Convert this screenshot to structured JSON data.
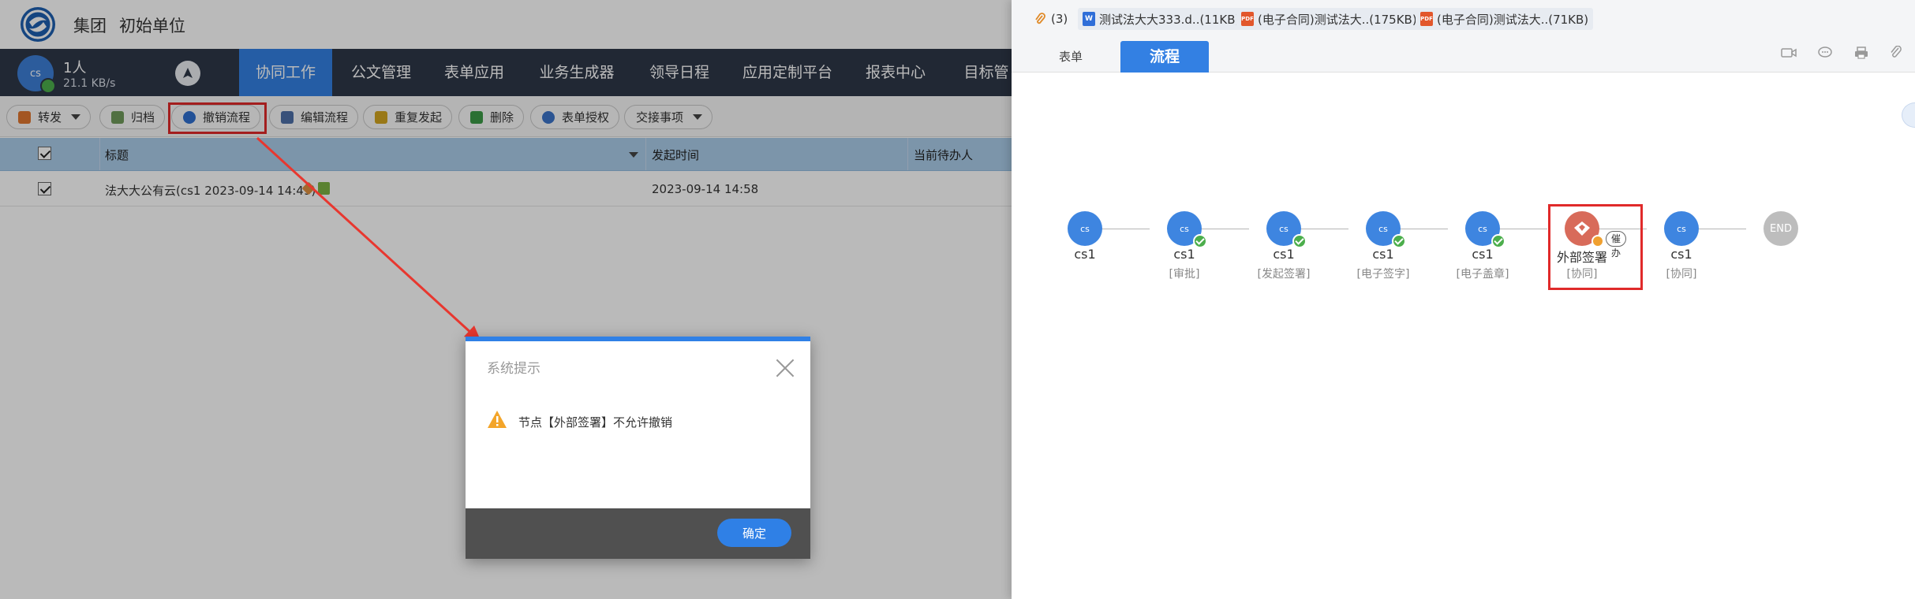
{
  "header": {
    "group": "集团",
    "unit": "初始单位"
  },
  "nav": {
    "avatar": "cs",
    "user": "1人",
    "speed": "21.1 KB/s",
    "tabs": [
      "协同工作",
      "公文管理",
      "表单应用",
      "业务生成器",
      "领导日程",
      "应用定制平台",
      "报表中心",
      "目标管"
    ]
  },
  "toolbar": {
    "forward": "转发",
    "archive": "归档",
    "revoke": "撤销流程",
    "edit": "编辑流程",
    "resend": "重复发起",
    "delete": "删除",
    "auth": "表单授权",
    "handover": "交接事项"
  },
  "table": {
    "headers": [
      "标题",
      "发起时间",
      "当前待办人"
    ],
    "rows": [
      {
        "title": "法大大公有云(cs1 2023-09-14 14:49)",
        "time": "2023-09-14 14:58",
        "pending": ""
      }
    ]
  },
  "dialog": {
    "title": "系统提示",
    "message": "节点【外部签署】不允许撤销",
    "ok": "确定"
  },
  "attachments": {
    "count": "(3)",
    "files": [
      {
        "type": "W",
        "name": "测试法大大333.d..(11KB)"
      },
      {
        "type": "PDF",
        "name": "(电子合同)测试法大..(175KB)"
      },
      {
        "type": "PDF",
        "name": "(电子合同)测试法大..(71KB)"
      }
    ]
  },
  "tabs": {
    "form": "表单",
    "flow": "流程"
  },
  "flow": {
    "nodes": [
      {
        "avatar": "cs",
        "name": "cs1",
        "sub": ""
      },
      {
        "avatar": "cs",
        "name": "cs1",
        "sub": "[审批]"
      },
      {
        "avatar": "cs",
        "name": "cs1",
        "sub": "[发起签署]"
      },
      {
        "avatar": "cs",
        "name": "cs1",
        "sub": "[电子签字]"
      },
      {
        "avatar": "cs",
        "name": "cs1",
        "sub": "[电子盖章]"
      },
      {
        "avatar": "",
        "name": "外部签署",
        "sub": "[协同]",
        "urge": "催办"
      },
      {
        "avatar": "cs",
        "name": "cs1",
        "sub": "[协同]"
      },
      {
        "avatar": "END",
        "name": "",
        "sub": ""
      }
    ]
  },
  "colors": {
    "accent": "#3380e3",
    "nav_bg": "#2e3748",
    "highlight": "#e02a2a"
  }
}
